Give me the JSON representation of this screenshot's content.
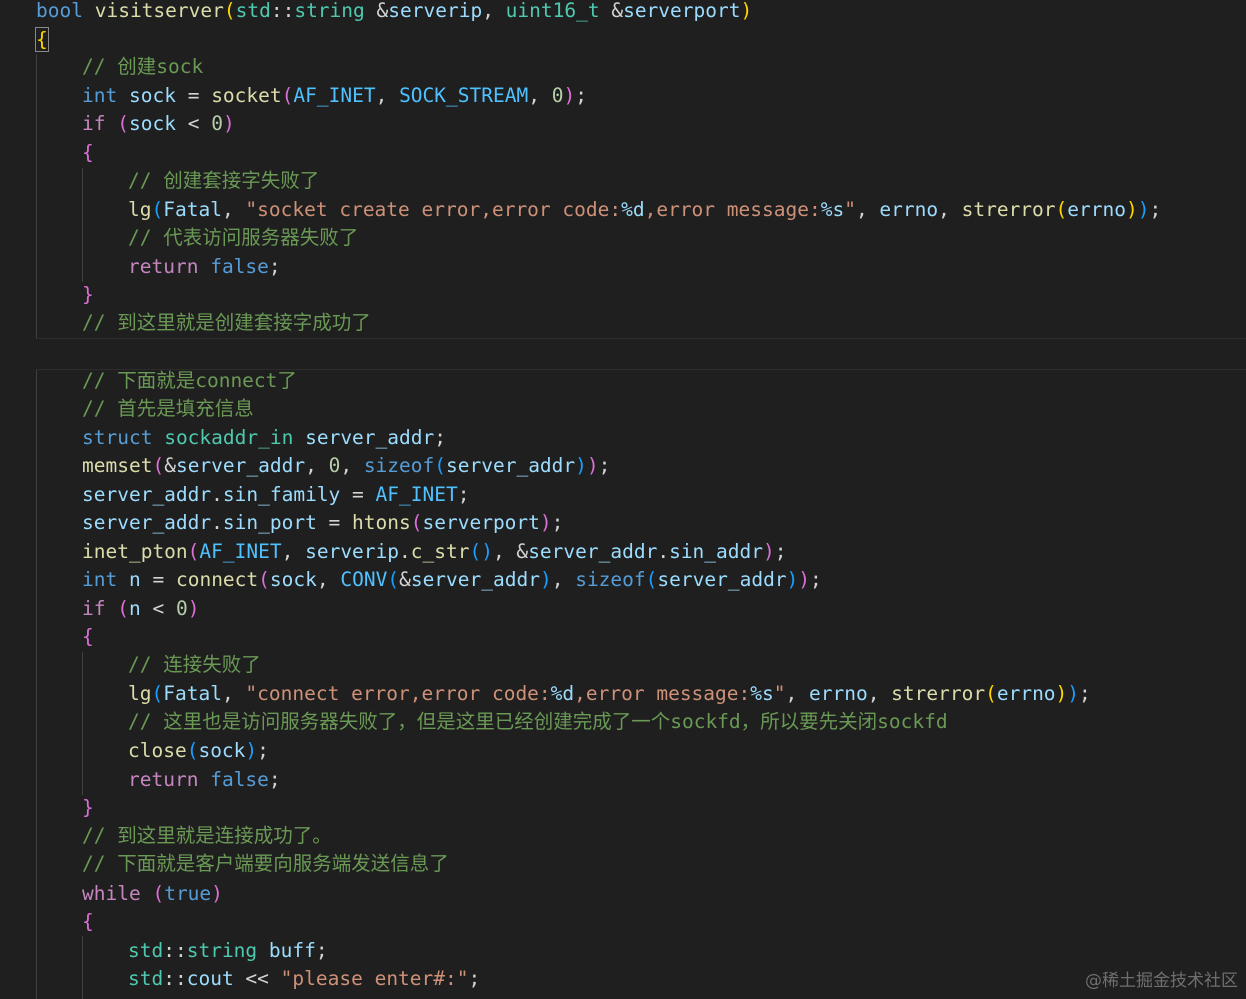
{
  "editor": {
    "lines": [
      "bool visitserver(std::string &serverip, uint16_t &serverport)",
      "{",
      "// 创建sock",
      "int sock = socket(AF_INET, SOCK_STREAM, 0);",
      "if (sock < 0)",
      "{",
      "// 创建套接字失败了",
      "lg(Fatal, \"socket create error,error code:%d,error message:%s\", errno, strerror(errno));",
      "// 代表访问服务器失败了",
      "return false;",
      "}",
      "// 到这里就是创建套接字成功了",
      "",
      "// 下面就是connect了",
      "// 首先是填充信息",
      "struct sockaddr_in server_addr;",
      "memset(&server_addr, 0, sizeof(server_addr));",
      "server_addr.sin_family = AF_INET;",
      "server_addr.sin_port = htons(serverport);",
      "inet_pton(AF_INET, serverip.c_str(), &server_addr.sin_addr);",
      "int n = connect(sock, CONV(&server_addr), sizeof(server_addr));",
      "if (n < 0)",
      "{",
      "// 连接失败了",
      "lg(Fatal, \"connect error,error code:%d,error message:%s\", errno, strerror(errno));",
      "// 这里也是访问服务器失败了，但是这里已经创建完成了一个sockfd，所以要先关闭sockfd",
      "close(sock);",
      "return false;",
      "}",
      "// 到这里就是连接成功了。",
      "// 下面就是客户端要向服务端发送信息了",
      "while (true)",
      "{",
      "std::string buff;",
      "std::cout << \"please enter#:\";"
    ]
  },
  "watermark": "@稀土掘金技术社区",
  "theme": {
    "background": "#1f1f1f",
    "keyword": "#569cd6",
    "control": "#c586c0",
    "function": "#dcdcaa",
    "type": "#4ec9b0",
    "variable": "#9cdcfe",
    "comment": "#6a9955",
    "string": "#ce9178",
    "number": "#b5cea8"
  }
}
